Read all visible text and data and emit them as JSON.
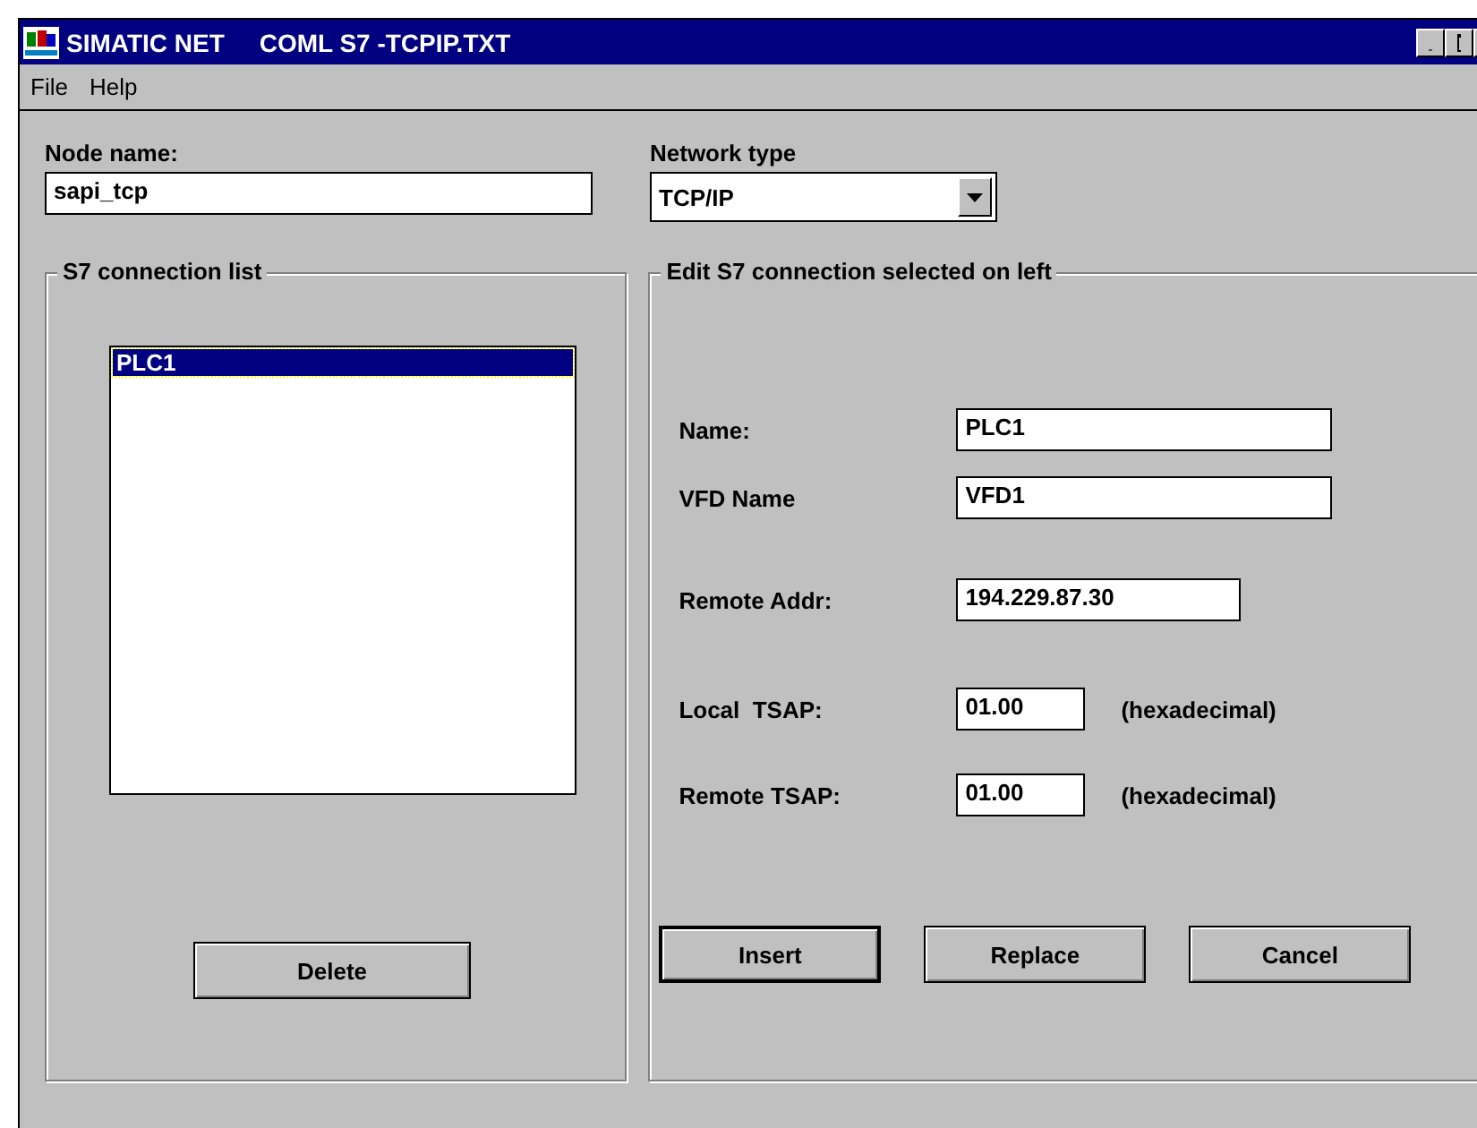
{
  "window": {
    "title": "SIMATIC NET     COML S7 -TCPIP.TXT"
  },
  "menu": [
    "File",
    "Help"
  ],
  "node_name": {
    "label": "Node name:",
    "value": "sapi_tcp"
  },
  "network_type": {
    "label": "Network type",
    "value": "TCP/IP"
  },
  "connection_list": {
    "title": "S7 connection list",
    "items": [
      {
        "label": "PLC1",
        "selected": true
      }
    ],
    "delete_button": "Delete"
  },
  "edit_panel": {
    "title": "Edit S7 connection selected on left",
    "fields": [
      {
        "label": "Name:",
        "value": "PLC1"
      },
      {
        "label": "VFD Name",
        "value": "VFD1"
      },
      {
        "label": "Remote Addr:",
        "value": "194.229.87.30"
      },
      {
        "label": "Local  TSAP:",
        "value": "01.00",
        "note": "(hexadecimal)"
      },
      {
        "label": "Remote TSAP:",
        "value": "01.00",
        "note": "(hexadecimal)"
      }
    ],
    "buttons": [
      {
        "label": "Insert",
        "default": true
      },
      {
        "label": "Replace",
        "default": false
      },
      {
        "label": "Cancel",
        "default": false
      }
    ]
  }
}
